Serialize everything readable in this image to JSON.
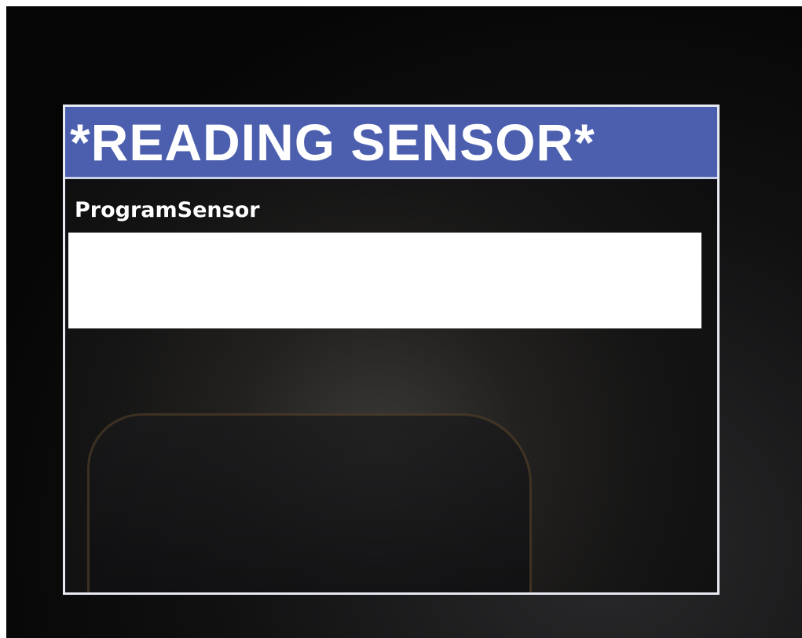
{
  "screen": {
    "title": "*READING SENSOR*",
    "subtitle": "ProgramSensor",
    "selected_row_text": ""
  },
  "colors": {
    "title_bar": "#4c5fae",
    "screen_border": "#e8eaf2",
    "highlight": "#ffffff"
  }
}
